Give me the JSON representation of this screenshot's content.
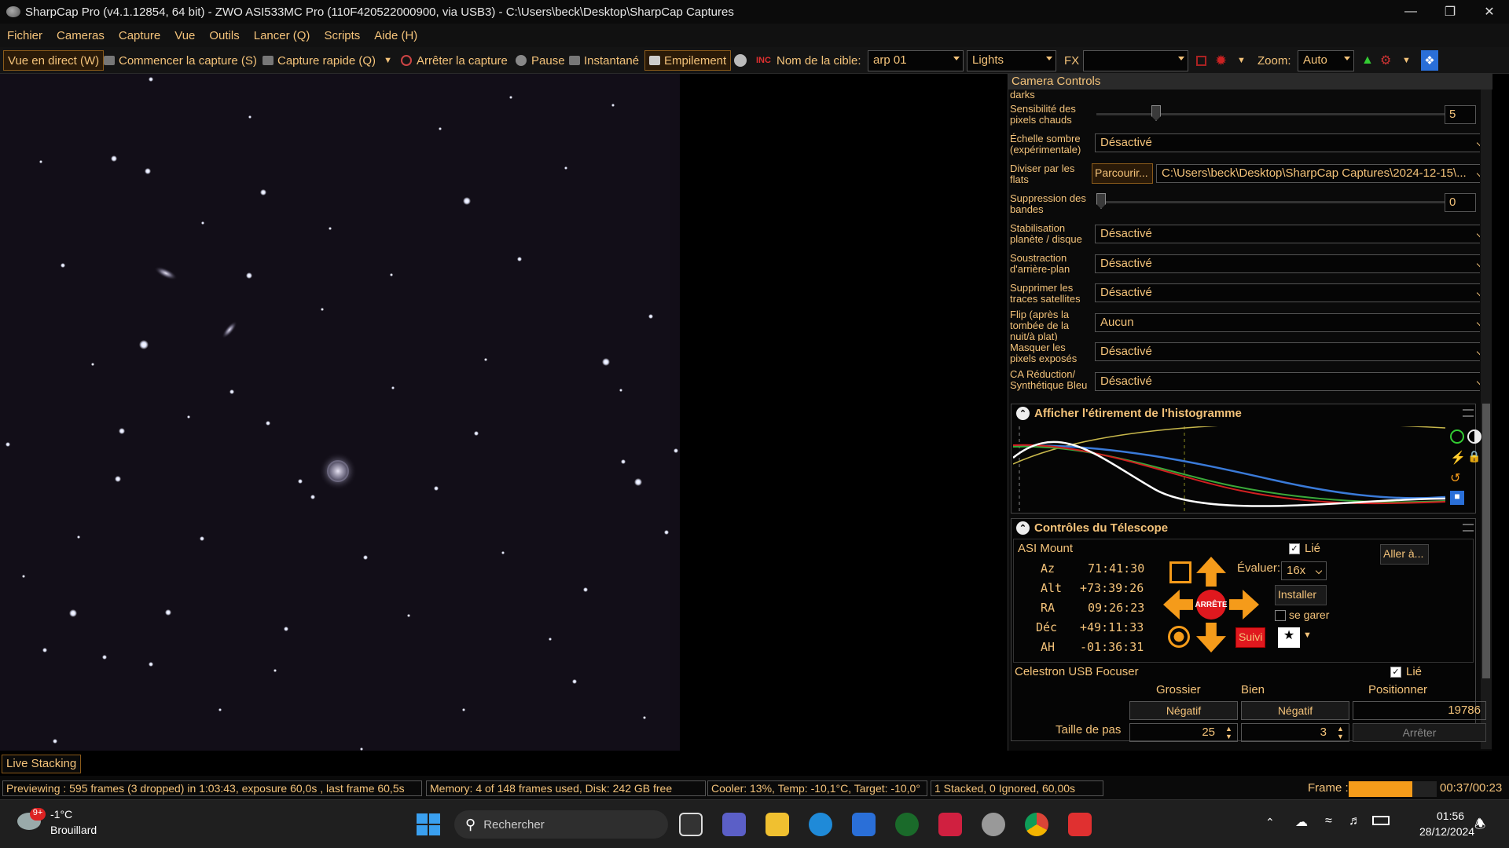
{
  "window": {
    "title": "SharpCap Pro (v4.1.12854, 64 bit) - ZWO ASI533MC Pro (110F420522000900, via USB3) - C:\\Users\\beck\\Desktop\\SharpCap Captures"
  },
  "menu": [
    "Fichier",
    "Cameras",
    "Capture",
    "Vue",
    "Outils",
    "Lancer (Q)",
    "Scripts",
    "Aide (H)"
  ],
  "toolbar": {
    "live": "Vue en direct (W)",
    "start": "Commencer la capture (S)",
    "quick": "Capture rapide (Q)",
    "stop": "Arrêter la capture",
    "pause": "Pause",
    "snapshot": "Instantané",
    "stack": "Empilement",
    "target_label": "Nom de la cible:",
    "target": "arp 01",
    "frame_type": "Lights",
    "fx_label": "FX",
    "fx": "",
    "zoom_label": "Zoom:",
    "zoom": "Auto"
  },
  "camera_controls": {
    "title": "Camera Controls",
    "rows": [
      {
        "label": "darks"
      },
      {
        "label": "Sensibilité des pixels chauds",
        "slider": 5,
        "value": "5"
      },
      {
        "label": "Échelle sombre (expérimentale)",
        "value": "Désactivé"
      },
      {
        "label": "Diviser par les flats",
        "button": "Parcourir...",
        "value": "C:\\Users\\beck\\Desktop\\SharpCap Captures\\2024-12-15\\..."
      },
      {
        "label": "Suppression des bandes",
        "slider": 0,
        "value": "0"
      },
      {
        "label": "Stabilisation planète / disque",
        "value": "Désactivé"
      },
      {
        "label": "Soustraction d'arrière-plan",
        "value": "Désactivé"
      },
      {
        "label": "Supprimer les traces satellites",
        "value": "Désactivé"
      },
      {
        "label": "Flip (après la tombée de la nuit/à plat)",
        "value": "Aucun"
      },
      {
        "label": "Masquer les pixels exposés",
        "value": "Désactivé"
      },
      {
        "label": "CA Réduction/ Synthétique Bleu",
        "value": "Désactivé"
      }
    ]
  },
  "histogram": {
    "title": "Afficher l'étirement de l'histogramme"
  },
  "telescope": {
    "title": "Contrôles du Télescope",
    "mount": "ASI Mount",
    "linked_label": "Lié",
    "linked": true,
    "coords": [
      {
        "k": "Az",
        "v": "71:41:30"
      },
      {
        "k": "Alt",
        "v": "+73:39:26"
      },
      {
        "k": "RA",
        "v": "09:26:23"
      },
      {
        "k": "Déc",
        "v": "+49:11:33"
      },
      {
        "k": "AH",
        "v": "-01:36:31"
      }
    ],
    "rate_label": "Évaluer:",
    "rate": "16x",
    "goto": "Aller à...",
    "install": "Installer",
    "park": "se garer",
    "stop": "ARRÊTE",
    "track": "Suivi"
  },
  "focuser": {
    "name": "Celestron USB Focuser",
    "linked_label": "Lié",
    "coarse": "Grossier",
    "fine": "Bien",
    "position_label": "Positionner",
    "neg1": "Négatif",
    "neg2": "Négatif",
    "position": "19786",
    "step_label": "Taille de pas",
    "step1": "25",
    "step2": "3",
    "stop": "Arrêter"
  },
  "live_stacking": "Live Stacking",
  "status": {
    "preview": "Previewing : 595 frames (3 dropped) in 1:03:43, exposure 60,0s , last frame 60,5s",
    "memory": "Memory: 4 of 148 frames used, Disk: 242 GB free",
    "cooler": "Cooler: 13%, Temp: -10,1°C, Target: -10,0°",
    "stacked": "1 Stacked, 0 Ignored, 60,00s",
    "frame_label": "Frame :",
    "frame_progress": 0.72,
    "frame_time": "00:37/00:23"
  },
  "taskbar": {
    "temp": "-1°C",
    "weather": "Brouillard",
    "badge": "9+",
    "search": "Rechercher",
    "time": "01:56",
    "date": "28/12/2024"
  },
  "colors": {
    "accent": "#f4c37a",
    "orange": "#f59b1a",
    "stop_red": "#e0181e"
  }
}
